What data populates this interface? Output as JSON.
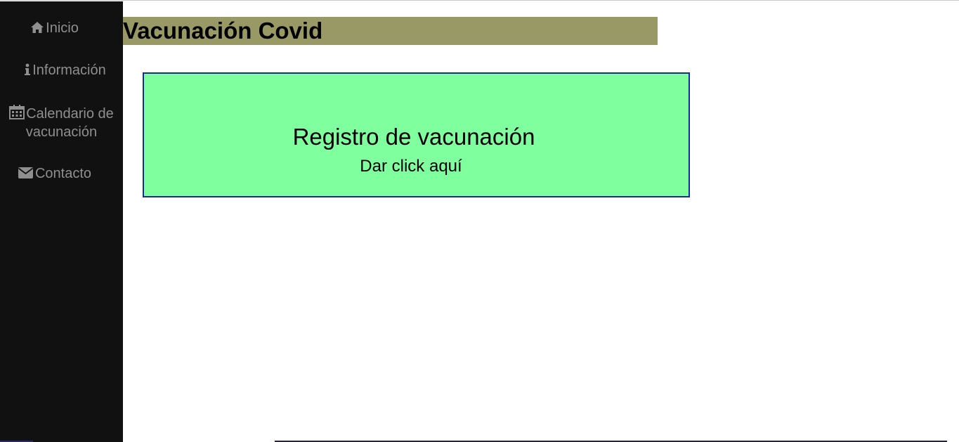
{
  "sidebar": {
    "items": [
      {
        "label": "Inicio",
        "icon": "home-icon"
      },
      {
        "label": "Información",
        "icon": "info-icon"
      },
      {
        "label": "Calendario de vacunación",
        "icon": "calendar-icon"
      },
      {
        "label": "Contacto",
        "icon": "envelope-icon"
      }
    ]
  },
  "header": {
    "title": "Vacunación Covid"
  },
  "registration": {
    "title": "Registro de vacunación",
    "subtitle": "Dar click aquí"
  },
  "colors": {
    "sidebar_bg": "#111111",
    "nav_text": "#8f8f8f",
    "title_bar_bg": "#999966",
    "card_bg": "#80ff9e",
    "card_border": "#1a2a9a"
  }
}
